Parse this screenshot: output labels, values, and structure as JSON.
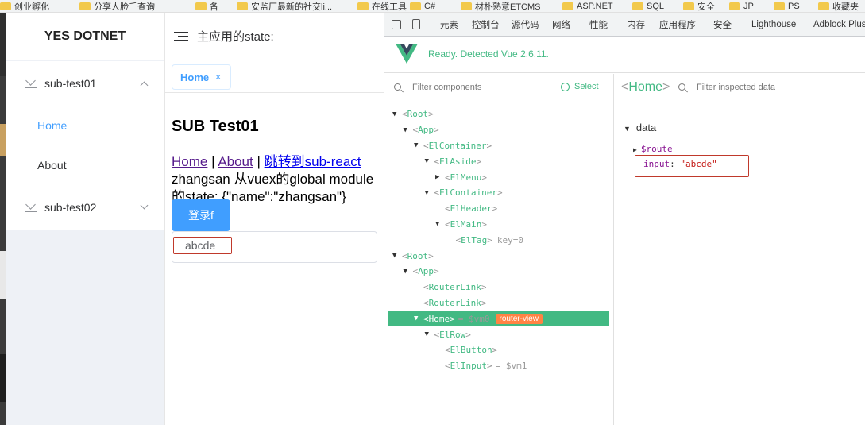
{
  "bookmarks": [
    {
      "label": "创业孵化"
    },
    {
      "label": "分享人脸千查询"
    },
    {
      "label": "备"
    },
    {
      "label": "安监厂最新的社交li..."
    },
    {
      "label": "在线工具"
    },
    {
      "label": "C#"
    },
    {
      "label": "材朴熟意ETCMS"
    },
    {
      "label": "ASP.NET"
    },
    {
      "label": "SQL"
    },
    {
      "label": "安全"
    },
    {
      "label": "JP"
    },
    {
      "label": "PS"
    },
    {
      "label": "收藏夹"
    }
  ],
  "sidebar": {
    "logo": "YES DOTNET",
    "submenus": [
      {
        "label": "sub-test01",
        "expanded": true,
        "items": [
          {
            "label": "Home",
            "active": true
          },
          {
            "label": "About",
            "active": false
          }
        ]
      },
      {
        "label": "sub-test02",
        "expanded": false
      }
    ]
  },
  "header": {
    "title": "主应用的state:"
  },
  "tags": [
    {
      "label": "Home",
      "close": "×"
    }
  ],
  "page": {
    "heading": "SUB Test01",
    "links": {
      "home": "Home",
      "sep1": "|",
      "about": "About",
      "sep2": "|",
      "jump": "跳转到sub-react"
    },
    "state_line1": "zhangsan 从vuex的global module",
    "state_line2": "的state: {\"name\":\"zhangsan\"}",
    "login_button": "登录f",
    "input_value": "abcde"
  },
  "devtools": {
    "tabs": [
      "元素",
      "控制台",
      "源代码",
      "网络",
      "性能",
      "内存",
      "应用程序",
      "安全",
      "Lighthouse",
      "Adblock Plus"
    ],
    "status": "Ready. Detected Vue 2.6.11.",
    "filter_components_placeholder": "Filter components",
    "select_label": "Select",
    "inspected_name": "Home",
    "filter_inspected_placeholder": "Filter inspected data",
    "tree": [
      {
        "name": "Root",
        "depth": 0,
        "toggle": "▼"
      },
      {
        "name": "App",
        "depth": 1,
        "toggle": "▼"
      },
      {
        "name": "ElContainer",
        "depth": 2,
        "toggle": "▼"
      },
      {
        "name": "ElAside",
        "depth": 3,
        "toggle": "▼"
      },
      {
        "name": "ElMenu",
        "depth": 4,
        "toggle": "▶"
      },
      {
        "name": "ElContainer",
        "depth": 3,
        "toggle": "▼"
      },
      {
        "name": "ElHeader",
        "depth": 4,
        "toggle": ""
      },
      {
        "name": "ElMain",
        "depth": 4,
        "toggle": "▼"
      },
      {
        "name": "ElTag",
        "depth": 5,
        "toggle": "",
        "key": "key=0"
      },
      {
        "name": "Root",
        "depth": 0,
        "toggle": "▼"
      },
      {
        "name": "App",
        "depth": 1,
        "toggle": "▼"
      },
      {
        "name": "RouterLink",
        "depth": 2,
        "toggle": ""
      },
      {
        "name": "RouterLink",
        "depth": 2,
        "toggle": ""
      },
      {
        "name": "Home",
        "depth": 2,
        "toggle": "▼",
        "selected": true,
        "suffix": "= $vm0",
        "badge": "router-view"
      },
      {
        "name": "ElRow",
        "depth": 3,
        "toggle": "▼"
      },
      {
        "name": "ElButton",
        "depth": 4,
        "toggle": ""
      },
      {
        "name": "ElInput",
        "depth": 4,
        "toggle": "",
        "suffix": "= $vm1"
      }
    ],
    "data_section": "data",
    "route_key": "$route",
    "input_key": "input",
    "input_val": "\"abcde\""
  }
}
